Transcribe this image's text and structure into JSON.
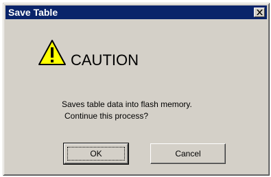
{
  "window": {
    "title": "Save Table",
    "close_icon": "close-icon"
  },
  "caution": {
    "icon": "warning-triangle-icon",
    "label": "CAUTION",
    "icon_fill": "#ffff00"
  },
  "message": {
    "line1": "Saves table data into flash memory.",
    "line2": "Continue this process?"
  },
  "buttons": {
    "ok_label": "OK",
    "cancel_label": "Cancel"
  },
  "colors": {
    "titlebar": "#0a246a",
    "dialog_face": "#d4d0c8"
  }
}
